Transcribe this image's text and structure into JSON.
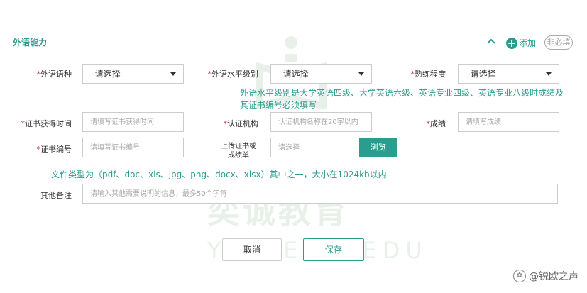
{
  "section": {
    "title": "外语能力",
    "add_label": "添加",
    "required_toggle": "非必填"
  },
  "fields": {
    "language": {
      "label": "*外语语种",
      "value": "--请选择--"
    },
    "level": {
      "label": "*外语水平级别",
      "value": "--请选择--"
    },
    "proficiency": {
      "label": "*熟练程度",
      "value": "--请选择--"
    },
    "level_hint": "外语水平级别是大学英语四级、大学英语六级、英语专业四级、英语专业八级时成绩及其证书编号必须填写",
    "cert_date": {
      "label": "*证书获得时间",
      "placeholder": "请填写证书获得时间"
    },
    "cert_org": {
      "label": "*认证机构",
      "placeholder": "认证机构名称在20字以内"
    },
    "score": {
      "label": "*成绩",
      "placeholder": "请填写成绩"
    },
    "cert_no": {
      "label": "*证书编号",
      "placeholder": "请填写证书编号"
    },
    "upload": {
      "label_line1": "上传证书或",
      "label_line2": "成绩单",
      "placeholder": "请选择",
      "browse_label": "浏览"
    },
    "file_hint": "文件类型为（pdf、doc、xls、jpg、png、docx、xlsx）其中之一，大小在1024kb以内",
    "remarks": {
      "label": "其他备注",
      "placeholder": "请输入其他需要说明的信息，最多50个字符"
    }
  },
  "actions": {
    "cancel_label": "取消",
    "save_label": "保存"
  },
  "watermark": {
    "cn": "奕诚教育",
    "en": "YICHENG EDU"
  },
  "source_mark": "@锐欧之声",
  "colors": {
    "accent": "#2a9d8f",
    "required": "#e53935",
    "border": "#cccccc"
  }
}
